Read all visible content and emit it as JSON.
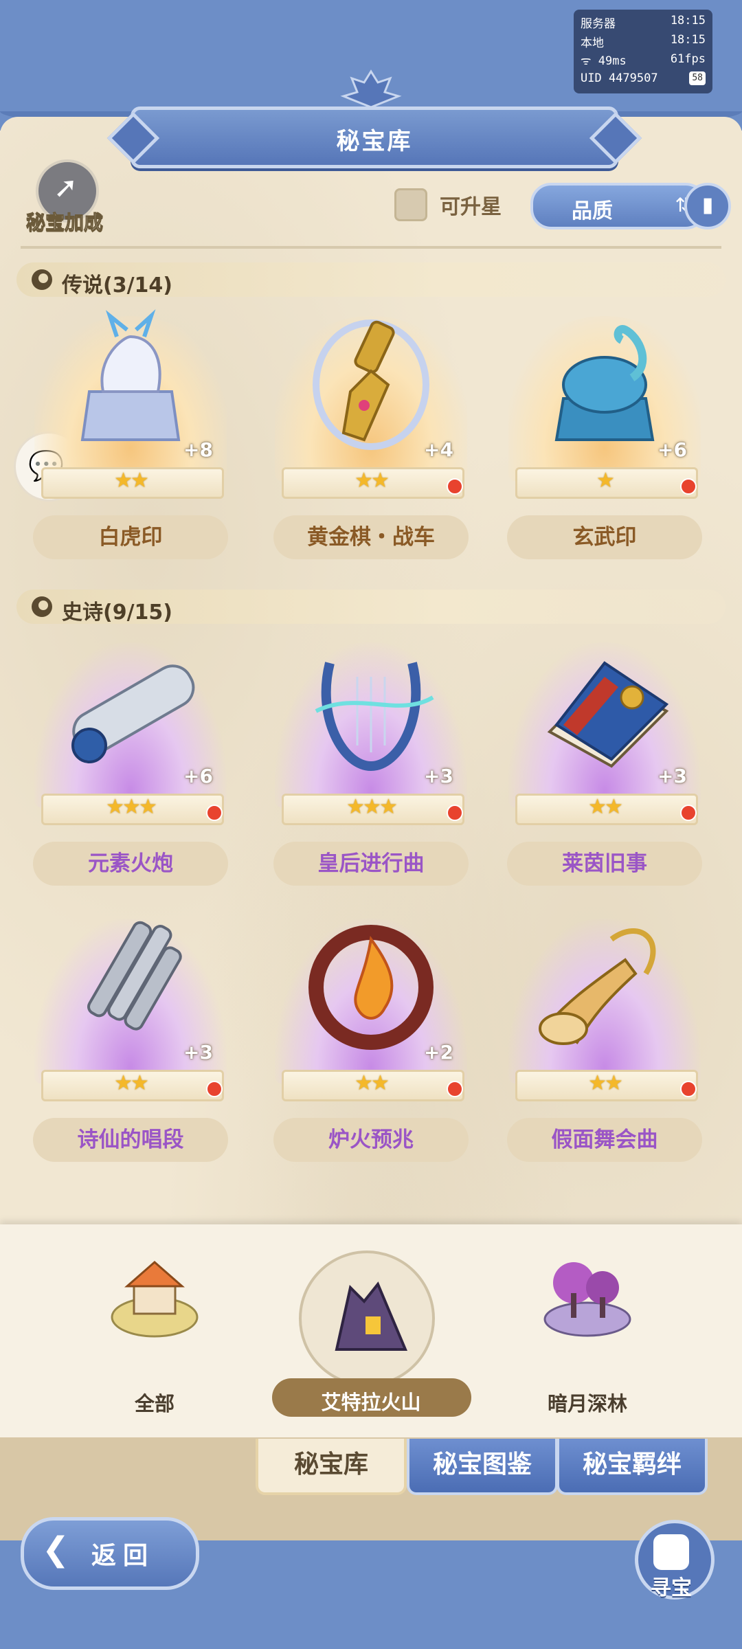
{
  "perf": {
    "server_label": "服务器",
    "server_time": "18:15",
    "local_label": "本地",
    "local_time": "18:15",
    "ping": "49ms",
    "fps": "61fps",
    "uid": "UID 4479507",
    "battery": "58"
  },
  "header": {
    "title": "秘宝库"
  },
  "toolbar": {
    "bonus_label": "秘宝加成",
    "upstar_label": "可升星",
    "sort_label": "品质"
  },
  "sections": {
    "legend": {
      "label": "传说(3/14)"
    },
    "epic": {
      "label": "史诗(9/15)"
    }
  },
  "legend_items": [
    {
      "name": "白虎印",
      "plus": "+8",
      "stars": "★★",
      "rarity": "legend"
    },
    {
      "name": "黄金棋・战车",
      "plus": "+4",
      "stars": "★★",
      "rarity": "legend"
    },
    {
      "name": "玄武印",
      "plus": "+6",
      "stars": "★",
      "rarity": "legend"
    }
  ],
  "epic_items": [
    {
      "name": "元素火炮",
      "plus": "+6",
      "stars": "★★★"
    },
    {
      "name": "皇后进行曲",
      "plus": "+3",
      "stars": "★★★"
    },
    {
      "name": "莱茵旧事",
      "plus": "+3",
      "stars": "★★"
    },
    {
      "name": "诗仙的唱段",
      "plus": "+3",
      "stars": "★★"
    },
    {
      "name": "炉火预兆",
      "plus": "+2",
      "stars": "★★"
    },
    {
      "name": "假面舞会曲",
      "plus": "",
      "stars": "★★"
    }
  ],
  "regions": [
    {
      "label": "全部"
    },
    {
      "label": "艾特拉火山",
      "selected": true
    },
    {
      "label": "暗月深林"
    }
  ],
  "tabs": [
    {
      "label": "秘宝库",
      "active": true
    },
    {
      "label": "秘宝图鉴",
      "active": false
    },
    {
      "label": "秘宝羁绊",
      "active": false
    }
  ],
  "footer": {
    "back_label": "返回",
    "treasure_label": "寻宝"
  },
  "colors": {
    "accent_blue": "#6d8ec7",
    "legend_gold": "#f6c67e",
    "epic_purple": "#c78be6",
    "notify_red": "#e8432e"
  }
}
